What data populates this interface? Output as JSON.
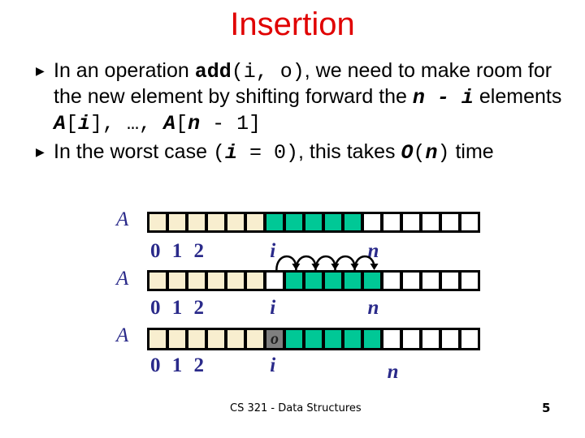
{
  "slide": {
    "title": "Insertion",
    "bullets": [
      {
        "parts": [
          {
            "text": "In an operation ",
            "style": "normal"
          },
          {
            "text": "add",
            "style": "mb"
          },
          {
            "text": "(i, o)",
            "style": "mono"
          },
          {
            "text": ", we need to make room for the new element by shifting forward the ",
            "style": "normal"
          },
          {
            "text": "n - i",
            "style": "mbi"
          },
          {
            "text": " elements ",
            "style": "normal"
          },
          {
            "text": "A",
            "style": "mbi"
          },
          {
            "text": "[",
            "style": "mono"
          },
          {
            "text": "i",
            "style": "mbi"
          },
          {
            "text": "], …, ",
            "style": "mono"
          },
          {
            "text": "A",
            "style": "mbi"
          },
          {
            "text": "[",
            "style": "mono"
          },
          {
            "text": "n",
            "style": "mbi"
          },
          {
            "text": " - 1]",
            "style": "mono"
          }
        ]
      },
      {
        "parts": [
          {
            "text": "In the worst case ",
            "style": "normal"
          },
          {
            "text": "(",
            "style": "mono"
          },
          {
            "text": "i",
            "style": "mbi"
          },
          {
            "text": " = 0)",
            "style": "mono"
          },
          {
            "text": ", this takes ",
            "style": "normal"
          },
          {
            "text": "O",
            "style": "mbi"
          },
          {
            "text": "(",
            "style": "mono"
          },
          {
            "text": "n",
            "style": "mbi"
          },
          {
            "text": ")",
            "style": "mono"
          },
          {
            "text": " time",
            "style": "normal"
          }
        ]
      }
    ],
    "bullet_icon": "triangle-right-icon",
    "footer": "CS 321 - Data Structures",
    "page_number": "5"
  },
  "diagram": {
    "array_label": "A",
    "index_labels": "0 1 2",
    "i_label": "i",
    "n_label": "n",
    "colors": {
      "beige": "#f8eecf",
      "teal": "#00c896",
      "white": "#ffffff",
      "gray": "#7f7f7f"
    },
    "rows": [
      {
        "cells": [
          "beige",
          "beige",
          "beige",
          "beige",
          "beige",
          "beige",
          "teal",
          "teal",
          "teal",
          "teal",
          "teal",
          "white",
          "white",
          "white",
          "white",
          "white",
          "white"
        ],
        "i_index": 6,
        "n_index": 11,
        "arrows": true
      },
      {
        "cells": [
          "beige",
          "beige",
          "beige",
          "beige",
          "beige",
          "beige",
          "white",
          "teal",
          "teal",
          "teal",
          "teal",
          "teal",
          "white",
          "white",
          "white",
          "white",
          "white"
        ],
        "i_index": 6,
        "n_index": 11,
        "arrows": false
      },
      {
        "cells": [
          "beige",
          "beige",
          "beige",
          "beige",
          "beige",
          "beige",
          "gray",
          "teal",
          "teal",
          "teal",
          "teal",
          "teal",
          "white",
          "white",
          "white",
          "white",
          "white"
        ],
        "i_index": 6,
        "n_index": 12,
        "arrows": false,
        "new_element_label": "o",
        "new_element_index": 6
      }
    ]
  }
}
